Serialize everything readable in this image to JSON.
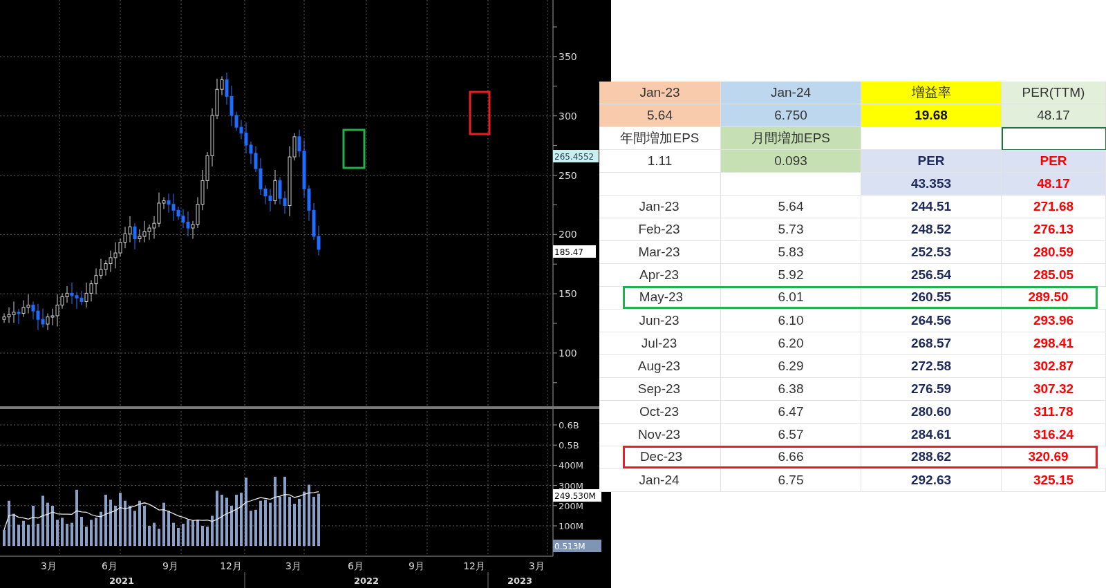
{
  "chart": {
    "price_ticks": [
      "350",
      "300",
      "250",
      "200",
      "150",
      "100"
    ],
    "price_tags": [
      {
        "kind": "reference",
        "text": "265.4552"
      },
      {
        "kind": "last",
        "text": "185.47"
      }
    ],
    "volume_ticks": [
      "0.6B",
      "0.5B",
      "400M",
      "300M",
      "200M",
      "100M"
    ],
    "volume_tags": [
      {
        "kind": "average",
        "text": "249.530M"
      },
      {
        "kind": "low",
        "text": "0.513M"
      }
    ],
    "months": [
      "3月",
      "6月",
      "9月",
      "12月",
      "3月",
      "6月",
      "9月",
      "12月",
      "3月"
    ],
    "years": [
      "2021",
      "2022",
      "2023"
    ],
    "frames": [
      {
        "color": "#22b14c"
      },
      {
        "color": "#ed1c24"
      }
    ]
  },
  "sheet": {
    "summary": [
      [
        {
          "text": "Jan-23",
          "color": "#f8cbad",
          "kind": "plain",
          "selected": false
        },
        {
          "text": "Jan-24",
          "color": "#bdd7ee",
          "kind": "plain",
          "selected": false
        },
        {
          "text": "増益率",
          "color": "#ffff00",
          "kind": "plain",
          "selected": false
        },
        {
          "text": "PER(TTM)",
          "color": "#e2efda",
          "kind": "plain",
          "selected": false
        }
      ],
      [
        {
          "text": "5.64",
          "color": "#f8cbad",
          "kind": "plain",
          "selected": false
        },
        {
          "text": "6.750",
          "color": "#bdd7ee",
          "kind": "plain",
          "selected": false
        },
        {
          "text": "19.68",
          "color": "#ffff00",
          "kind": "bold",
          "selected": false
        },
        {
          "text": "48.17",
          "color": "#e2efda",
          "kind": "plain",
          "selected": false
        }
      ],
      [
        {
          "text": "年間増加EPS",
          "kind": "plain",
          "selected": false
        },
        {
          "text": "月間増加EPS",
          "color": "#c6e0b4",
          "kind": "plain",
          "selected": false
        },
        {
          "kind": "plain",
          "selected": false
        },
        {
          "kind": "plain",
          "selected": true
        }
      ],
      [
        {
          "text": "1.11",
          "kind": "plain",
          "selected": false
        },
        {
          "text": "0.093",
          "color": "#c6e0b4",
          "kind": "plain",
          "selected": false
        },
        {
          "text": "PER",
          "color": "#d9e1f2",
          "kind": "navy",
          "selected": false
        },
        {
          "text": "PER",
          "color": "#d9e1f2",
          "kind": "red",
          "selected": false
        }
      ],
      [
        {
          "kind": "plain",
          "selected": false
        },
        {
          "kind": "plain",
          "selected": false
        },
        {
          "text": "43.353",
          "color": "#d9e1f2",
          "kind": "navy",
          "selected": false
        },
        {
          "text": "48.17",
          "color": "#d9e1f2",
          "kind": "red",
          "selected": false
        }
      ]
    ],
    "rows": [
      {
        "cells": [
          "Jan-23",
          "5.64",
          "244.51",
          "271.68"
        ]
      },
      {
        "cells": [
          "Feb-23",
          "5.73",
          "248.52",
          "276.13"
        ]
      },
      {
        "cells": [
          "Mar-23",
          "5.83",
          "252.53",
          "280.59"
        ]
      },
      {
        "cells": [
          "Apr-23",
          "5.92",
          "256.54",
          "285.05"
        ]
      },
      {
        "cells": [
          "May-23",
          "6.01",
          "260.55",
          "289.50"
        ],
        "color": "#22b14c"
      },
      {
        "cells": [
          "Jun-23",
          "6.10",
          "264.56",
          "293.96"
        ]
      },
      {
        "cells": [
          "Jul-23",
          "6.20",
          "268.57",
          "298.41"
        ]
      },
      {
        "cells": [
          "Aug-23",
          "6.29",
          "272.58",
          "302.87"
        ]
      },
      {
        "cells": [
          "Sep-23",
          "6.38",
          "276.59",
          "307.32"
        ]
      },
      {
        "cells": [
          "Oct-23",
          "6.47",
          "280.60",
          "311.78"
        ]
      },
      {
        "cells": [
          "Nov-23",
          "6.57",
          "284.61",
          "316.24"
        ]
      },
      {
        "cells": [
          "Dec-23",
          "6.66",
          "288.62",
          "320.69"
        ],
        "color": "#ed1c24"
      },
      {
        "cells": [
          "Jan-24",
          "6.75",
          "292.63",
          "325.15"
        ]
      }
    ]
  }
}
